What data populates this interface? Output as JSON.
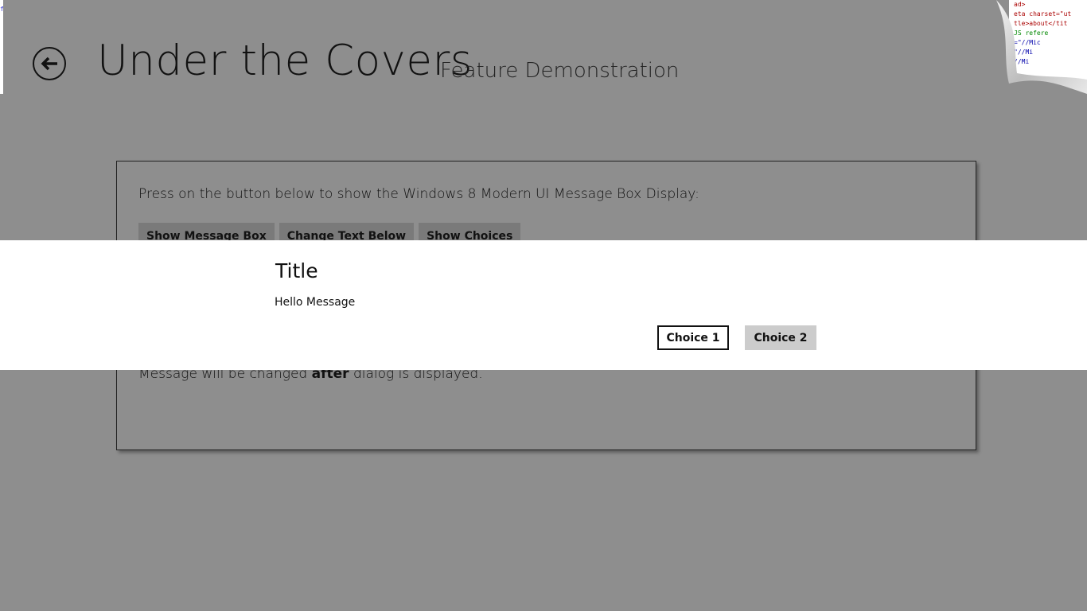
{
  "header": {
    "title": "Under the Covers",
    "subtitle": "Feature Demonstration",
    "back_icon": "back-arrow-icon"
  },
  "code_peek": [
    "ad>",
    "eta charset=\"ut",
    "tle>about</tit",
    "",
    "JS refere",
    "=\"//Mic",
    "\"//Mi",
    "//Mi"
  ],
  "panel": {
    "instruction": "Press on the button below to show the Windows 8 Modern UI Message Box Display:",
    "buttons": [
      "Show Message Box",
      "Change Text Below",
      "Show Choices"
    ],
    "status_before": "Message will be changed ",
    "status_bold": "after",
    "status_after": " dialog is displayed."
  },
  "dialog": {
    "title": "Title",
    "message": "Hello Message",
    "choice1": "Choice 1",
    "choice2": "Choice 2"
  }
}
